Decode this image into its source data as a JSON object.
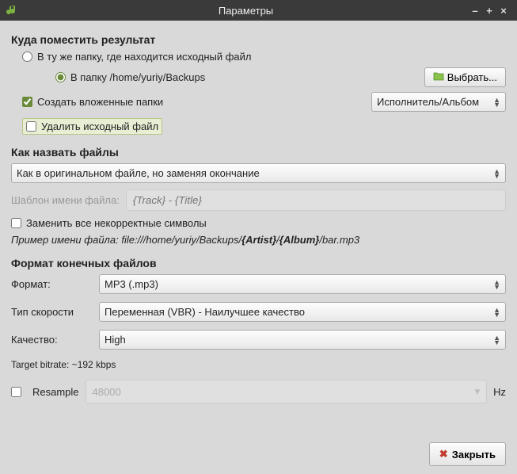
{
  "window": {
    "title": "Параметры"
  },
  "sections": {
    "placement": {
      "title": "Куда поместить результат",
      "same_folder": "В ту же папку, где находится исходный файл",
      "into_folder_prefix": "В папку ",
      "into_folder_path": "/home/yuriy/Backups",
      "choose_button": "Выбрать...",
      "create_subfolders": "Создать вложенные папки",
      "subfolder_combo": "Исполнитель/Альбом",
      "delete_original": "Удалить исходный файл"
    },
    "naming": {
      "title": "Как назвать файлы",
      "combo": "Как в оригинальном файле, но заменяя окончание",
      "pattern_label": "Шаблон имени файла:",
      "pattern_placeholder": "{Track} - {Title}",
      "replace_bad": "Заменить все некорректные символы",
      "example_label": "Пример имени файла:",
      "example_prefix": " file:///home/yuriy/Backups/",
      "example_artist": "{Artist}",
      "example_sep": "/",
      "example_album": "{Album}",
      "example_suffix": "/bar.mp3"
    },
    "format": {
      "title": "Формат конечных файлов",
      "format_label": "Формат:",
      "format_value": "MP3   (.mp3)",
      "bitrate_type_label": "Тип скорости",
      "bitrate_type_value": "Переменная (VBR) - Наилучшее качество",
      "quality_label": "Качество:",
      "quality_value": "High",
      "target_bitrate": "Target bitrate: ~192 kbps",
      "resample_label": "Resample",
      "resample_value": "48000",
      "hz": "Hz"
    }
  },
  "footer": {
    "close": "Закрыть"
  }
}
